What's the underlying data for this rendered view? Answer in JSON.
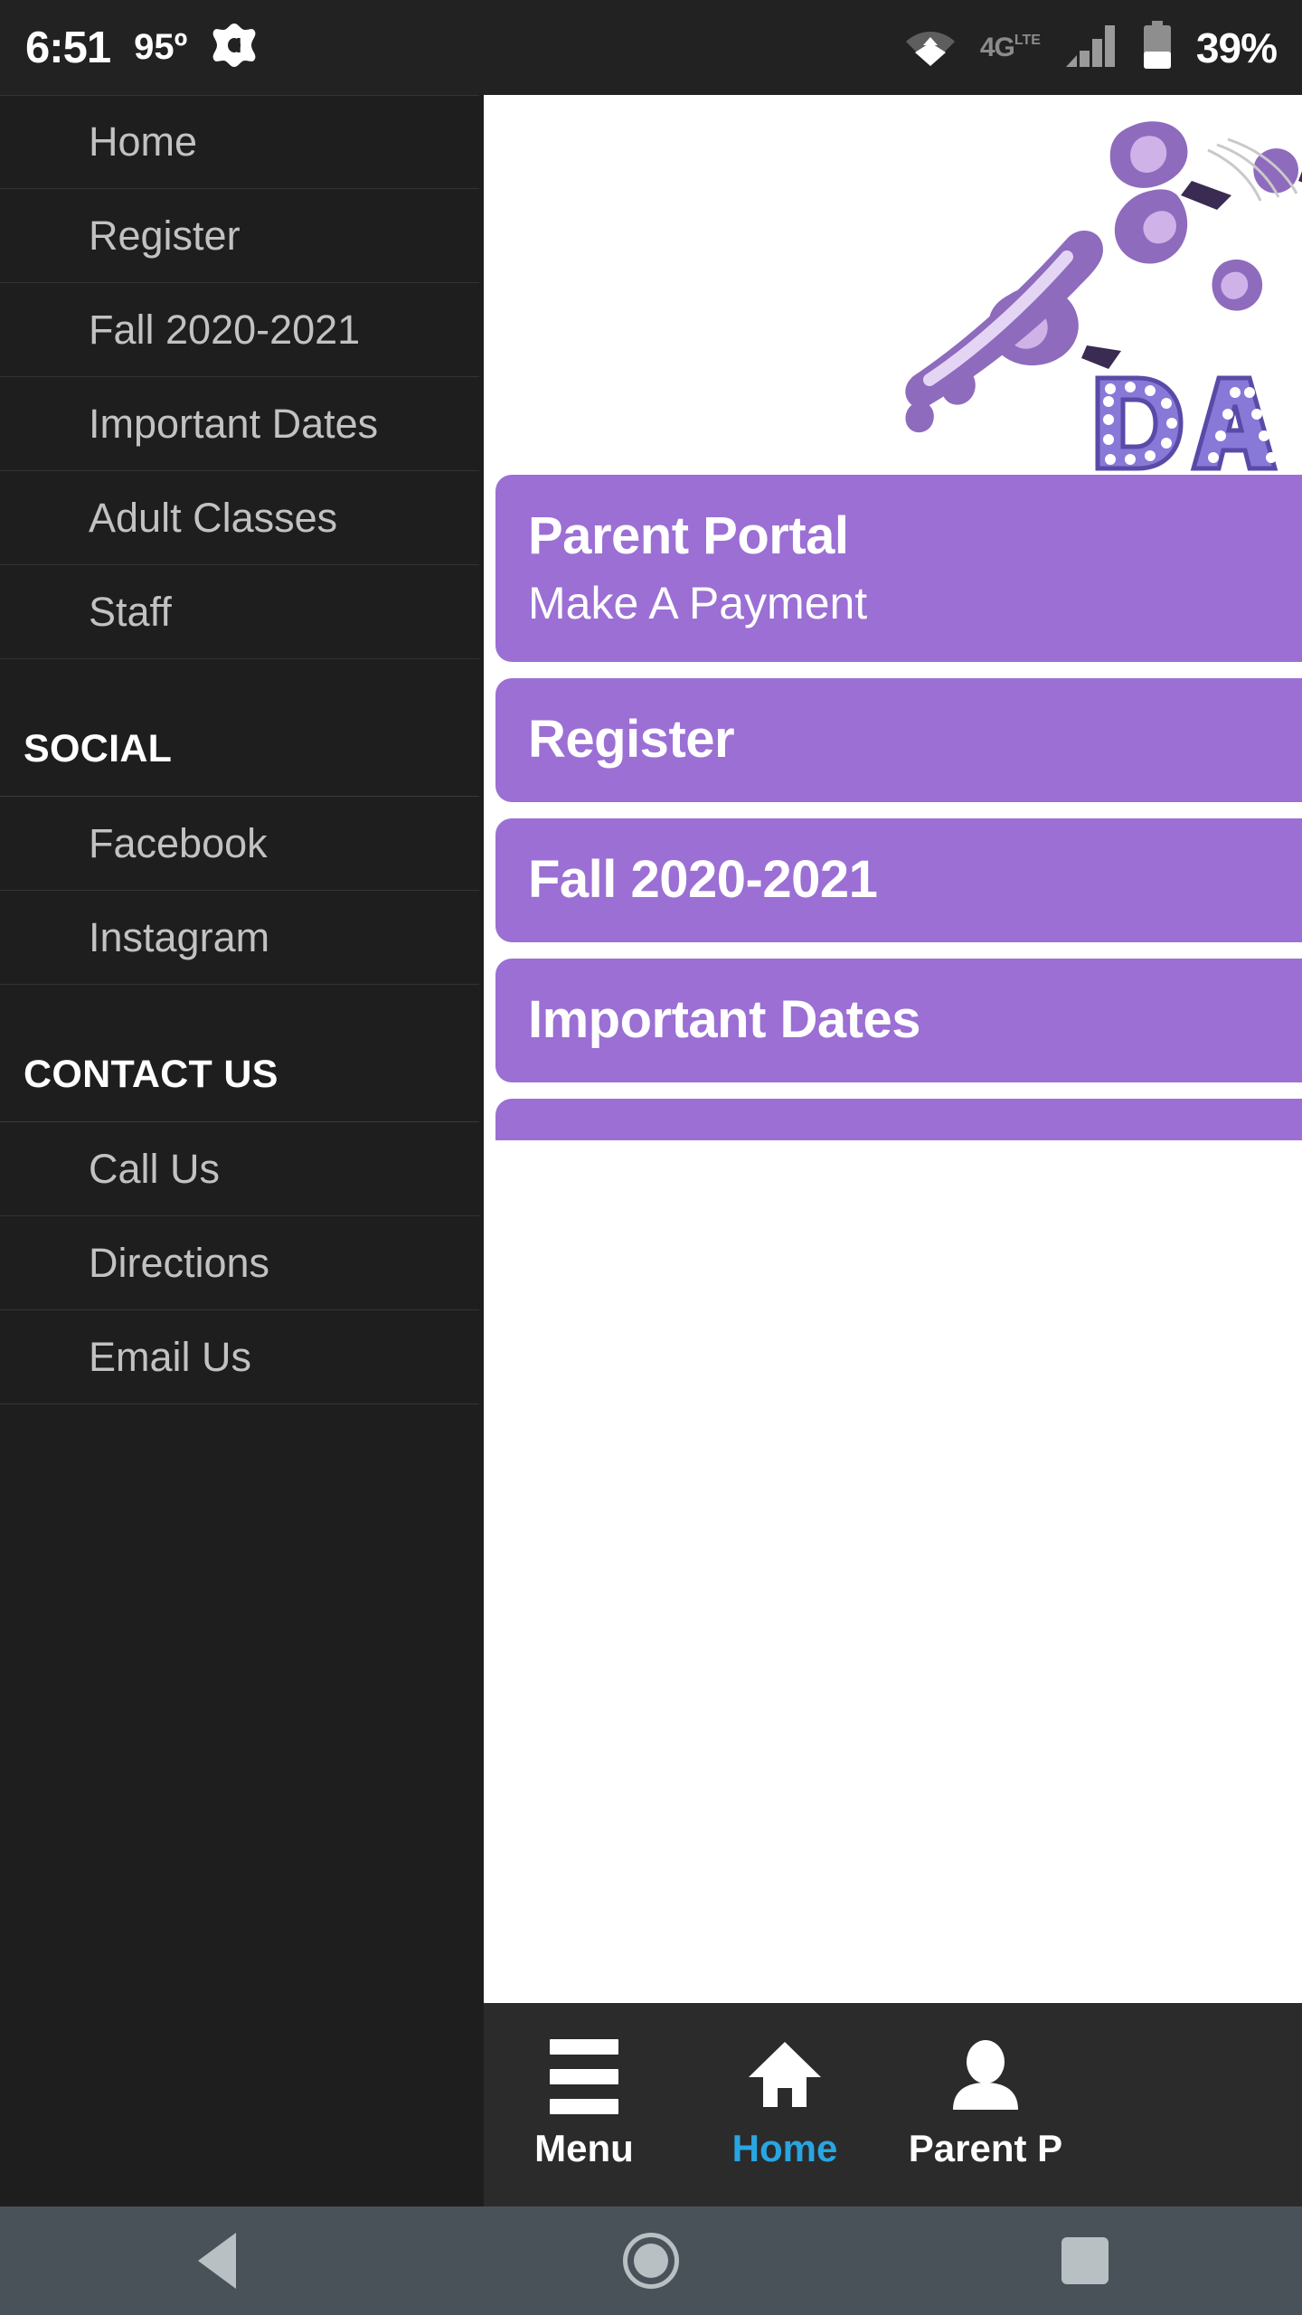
{
  "status_bar": {
    "time": "6:51",
    "temperature": "95º",
    "app_icon": "avast-icon",
    "wifi_icon": "wifi-icon",
    "network_label": "4G",
    "network_sup": "LTE",
    "signal_icon": "signal-bars-icon",
    "battery_icon": "battery-icon",
    "battery_percent": "39%"
  },
  "drawer": {
    "items": [
      {
        "label": "Home"
      },
      {
        "label": "Register"
      },
      {
        "label": "Fall 2020-2021"
      },
      {
        "label": "Important Dates"
      },
      {
        "label": "Adult Classes"
      },
      {
        "label": "Staff"
      }
    ],
    "social_header": "SOCIAL",
    "social_items": [
      {
        "label": "Facebook"
      },
      {
        "label": "Instagram"
      }
    ],
    "contact_header": "CONTACT US",
    "contact_items": [
      {
        "label": "Call Us"
      },
      {
        "label": "Directions"
      },
      {
        "label": "Email Us"
      }
    ]
  },
  "main": {
    "logo_alt": "dance-studio-logo",
    "logo_text": "DA",
    "buttons": [
      {
        "title": "Parent Portal",
        "subtitle": "Make A Payment"
      },
      {
        "title": "Register",
        "subtitle": ""
      },
      {
        "title": "Fall 2020-2021",
        "subtitle": ""
      },
      {
        "title": "Important Dates",
        "subtitle": ""
      }
    ]
  },
  "tabbar": {
    "tabs": [
      {
        "label": "Menu",
        "icon": "hamburger-icon",
        "active": false
      },
      {
        "label": "Home",
        "icon": "home-icon",
        "active": true
      },
      {
        "label": "Parent P",
        "icon": "person-icon",
        "active": false
      }
    ]
  },
  "android_nav": {
    "back": "back-icon",
    "home": "home-circle-icon",
    "recents": "recents-icon"
  },
  "colors": {
    "accent_purple": "#9b6fd4",
    "active_blue": "#29a5e3",
    "drawer_bg": "#1e1e1e",
    "statusbar_bg": "#222222",
    "navbar_bg": "#4a5259"
  }
}
